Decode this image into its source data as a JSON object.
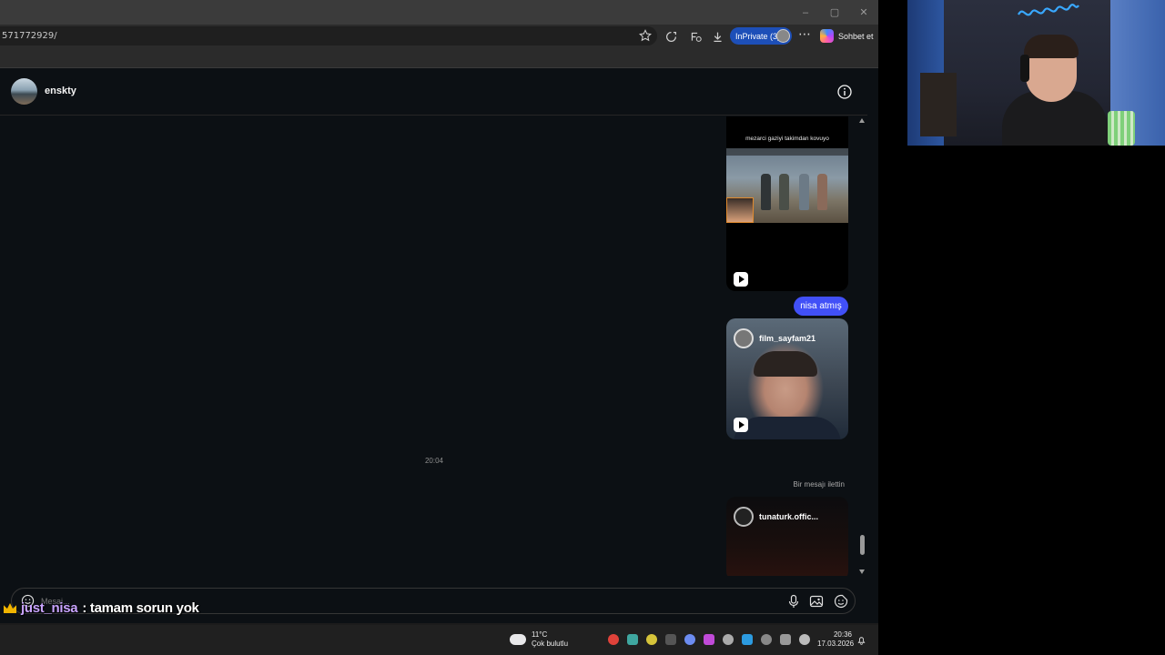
{
  "browser": {
    "url": "571772929/",
    "inprivate_label": "InPrivate (3)",
    "copilot_label": "Sohbet et",
    "window_controls": [
      "–",
      "▢",
      "✕"
    ]
  },
  "dm": {
    "username": "enskty",
    "messages": {
      "reel1_caption": "mezarci gaziyi takimdan kovuyo",
      "sent_text": "nisa atmış",
      "reel2_author": "film_sayfam21",
      "timestamp": "20:04",
      "forwarded_label": "Bir mesajı ilettin",
      "reel3_author": "tunaturk.offic..."
    },
    "composer": {
      "placeholder": "Mesaj..."
    }
  },
  "stream_overlay": {
    "chat_user": "just_nisa",
    "chat_message": ": tamam sorun yok"
  },
  "taskbar": {
    "weather_temp": "11°C",
    "weather_desc": "Çok bulutlu",
    "time": "20:36",
    "date": "17.03.2026"
  },
  "colors": {
    "bubble": "#4150f7",
    "inprivate": "#1d4fb8",
    "background": "#0c1014"
  }
}
